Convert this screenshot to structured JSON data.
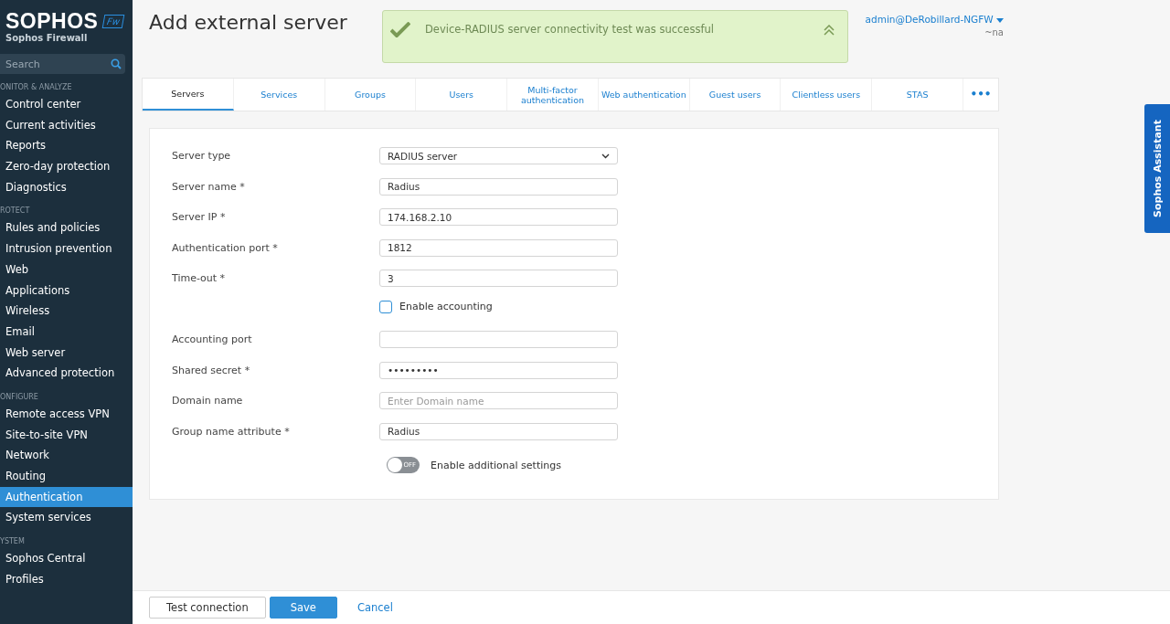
{
  "sidebar": {
    "logo": "SOPHOS",
    "logo_badge": "Fw",
    "product": "Sophos Firewall",
    "search": {
      "placeholder": "Search"
    },
    "sections": [
      {
        "heading": "ONITOR & ANALYZE",
        "items": [
          {
            "label": "Control center",
            "selected": false
          },
          {
            "label": "Current activities",
            "selected": false
          },
          {
            "label": "Reports",
            "selected": false
          },
          {
            "label": "Zero-day protection",
            "selected": false
          },
          {
            "label": "Diagnostics",
            "selected": false
          }
        ]
      },
      {
        "heading": "ROTECT",
        "items": [
          {
            "label": "Rules and policies",
            "selected": false
          },
          {
            "label": "Intrusion prevention",
            "selected": false
          },
          {
            "label": "Web",
            "selected": false
          },
          {
            "label": "Applications",
            "selected": false
          },
          {
            "label": "Wireless",
            "selected": false
          },
          {
            "label": "Email",
            "selected": false
          },
          {
            "label": "Web server",
            "selected": false
          },
          {
            "label": "Advanced protection",
            "selected": false
          }
        ]
      },
      {
        "heading": "ONFIGURE",
        "items": [
          {
            "label": "Remote access VPN",
            "selected": false
          },
          {
            "label": "Site-to-site VPN",
            "selected": false
          },
          {
            "label": "Network",
            "selected": false
          },
          {
            "label": "Routing",
            "selected": false
          },
          {
            "label": "Authentication",
            "selected": true
          },
          {
            "label": "System services",
            "selected": false
          }
        ]
      },
      {
        "heading": "YSTEM",
        "items": [
          {
            "label": "Sophos Central",
            "selected": false
          },
          {
            "label": "Profiles",
            "selected": false
          }
        ]
      }
    ]
  },
  "header": {
    "title": "Add external server",
    "user": "admin@DeRobillard-NGFW",
    "user_sub": "~na"
  },
  "toast": {
    "message": "Device-RADIUS server connectivity test was successful"
  },
  "tabs": [
    {
      "label": "Servers",
      "selected": true
    },
    {
      "label": "Services",
      "selected": false
    },
    {
      "label": "Groups",
      "selected": false
    },
    {
      "label": "Users",
      "selected": false
    },
    {
      "label": "Multi-factor authentication",
      "selected": false
    },
    {
      "label": "Web authentication",
      "selected": false
    },
    {
      "label": "Guest users",
      "selected": false
    },
    {
      "label": "Clientless users",
      "selected": false
    },
    {
      "label": "STAS",
      "selected": false
    }
  ],
  "more_tabs": "•••",
  "form": [
    {
      "kind": "select",
      "label": "Server type",
      "value": "RADIUS server"
    },
    {
      "kind": "text",
      "label": "Server name *",
      "value": "Radius"
    },
    {
      "kind": "text",
      "label": "Server IP *",
      "value": "174.168.2.10"
    },
    {
      "kind": "text",
      "label": "Authentication port *",
      "value": "1812"
    },
    {
      "kind": "text",
      "label": "Time-out *",
      "value": "3"
    },
    {
      "kind": "checkbox",
      "label": "Enable accounting",
      "checked": false
    },
    {
      "kind": "text",
      "label": "Accounting port"
    },
    {
      "kind": "text",
      "label": "Shared secret *",
      "value": "•••••••••"
    },
    {
      "kind": "text",
      "label": "Domain name",
      "placeholder": "Enter Domain name"
    },
    {
      "kind": "text",
      "label": "Group name attribute *",
      "value": "Radius"
    },
    {
      "kind": "toggle",
      "label": "Enable additional settings",
      "on": false,
      "state_text": "OFF"
    }
  ],
  "footer": [
    {
      "kind": "secondary",
      "label": "Test connection"
    },
    {
      "kind": "primary",
      "label": "Save"
    },
    {
      "kind": "link",
      "label": "Cancel"
    }
  ],
  "assistant": "Sophos Assistant"
}
